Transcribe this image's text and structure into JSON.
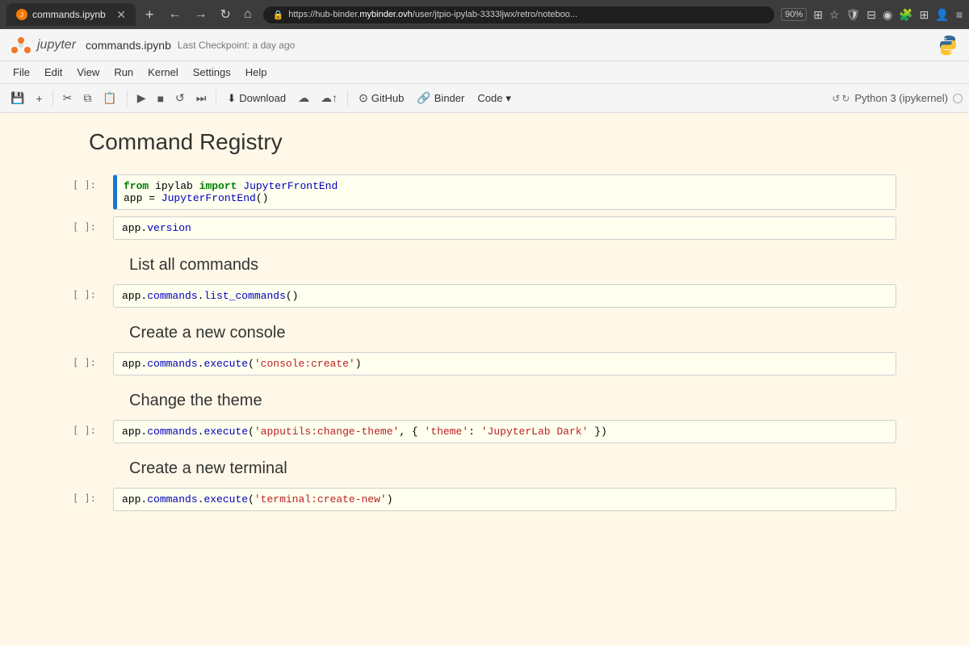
{
  "browser": {
    "tab_title": "commands.ipynb",
    "url_prefix": "https://hub-binder.",
    "url_highlight": "mybinder.ovh",
    "url_suffix": "/user/jtpio-ipylab-3333ljwx/retro/noteboo...",
    "zoom": "90%",
    "tab_add": "+"
  },
  "jupyter": {
    "logo_text": "jupyter",
    "notebook_name": "commands.ipynb",
    "checkpoint": "Last Checkpoint: a day ago"
  },
  "menu": {
    "items": [
      "File",
      "Edit",
      "View",
      "Run",
      "Kernel",
      "Settings",
      "Help"
    ]
  },
  "toolbar": {
    "download_label": "Download",
    "github_label": "GitHub",
    "binder_label": "Binder",
    "code_label": "Code",
    "kernel_label": "Python 3 (ipykernel)"
  },
  "notebook": {
    "title": "Command Registry",
    "sections": [
      {
        "id": "s1",
        "cells": [
          {
            "number": "[ ]:",
            "code_html": "<code><span class='kw'>from</span> ipylab <span class='kw'>import</span> <span class='mod'>JupyterFrontEnd</span></code><br><code>app = <span class='fn'>JupyterFrontEnd</span>()</code>",
            "active": true
          },
          {
            "number": "[ ]:",
            "code_html": "<code>app.<span class='attr'>version</span></code>",
            "active": false
          }
        ]
      },
      {
        "id": "s2",
        "header": "List all commands",
        "cells": [
          {
            "number": "[ ]:",
            "code_html": "<code>app.<span class='attr'>commands</span>.<span class='fn'>list_commands</span>()</code>",
            "active": false
          }
        ]
      },
      {
        "id": "s3",
        "header": "Create a new console",
        "cells": [
          {
            "number": "[ ]:",
            "code_html": "<code>app.<span class='attr'>commands</span>.<span class='fn'>execute</span>(<span class='str'>'console:create'</span>)</code>",
            "active": false
          }
        ]
      },
      {
        "id": "s4",
        "header": "Change the theme",
        "cells": [
          {
            "number": "[ ]:",
            "code_html": "<code>app.<span class='attr'>commands</span>.<span class='fn'>execute</span>(<span class='str'>'apputils:change-theme'</span>, { <span class='str'>'theme'</span>: <span class='str'>'JupyterLab Dark'</span> })</code>",
            "active": false
          }
        ]
      },
      {
        "id": "s5",
        "header": "Create a new terminal",
        "cells": [
          {
            "number": "[ ]:",
            "code_html": "<code>app.<span class='attr'>commands</span>.<span class='fn'>execute</span>(<span class='str'>'terminal:create-new'</span>)</code>",
            "active": false
          }
        ]
      }
    ]
  }
}
